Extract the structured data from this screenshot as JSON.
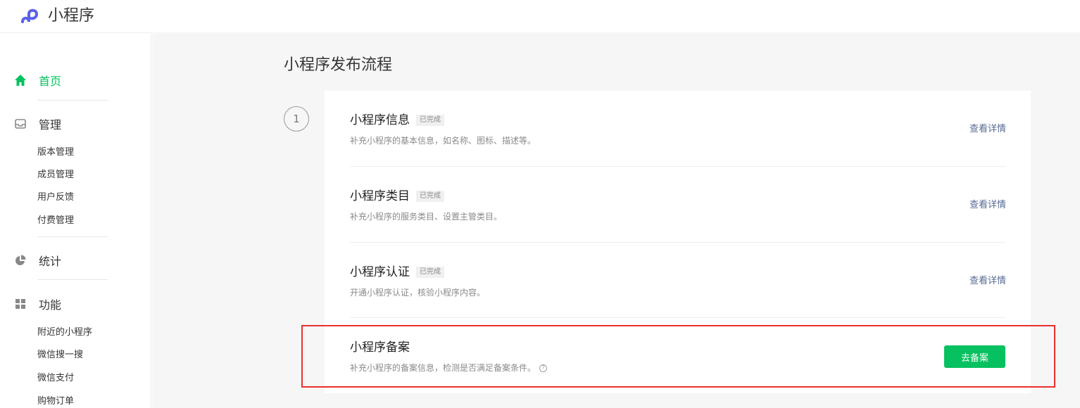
{
  "app": {
    "brand": "小程序"
  },
  "sidebar": {
    "home": "首页",
    "manage": "管理",
    "manage_items": [
      "版本管理",
      "成员管理",
      "用户反馈",
      "付费管理"
    ],
    "stats": "统计",
    "features": "功能",
    "feature_items": [
      "附近的小程序",
      "微信搜一搜",
      "微信支付",
      "购物订单"
    ]
  },
  "main": {
    "title": "小程序发布流程",
    "step_number": "1",
    "rows": [
      {
        "title": "小程序信息",
        "badge": "已完成",
        "desc": "补充小程序的基本信息，如名称、图标、描述等。",
        "link": "查看详情"
      },
      {
        "title": "小程序类目",
        "badge": "已完成",
        "desc": "补充小程序的服务类目、设置主管类目。",
        "link": "查看详情"
      },
      {
        "title": "小程序认证",
        "badge": "已完成",
        "desc": "开通小程序认证，核验小程序内容。",
        "link": "查看详情"
      },
      {
        "title": "小程序备案",
        "desc": "补充小程序的备案信息，检测是否满足备案条件。",
        "button": "去备案"
      }
    ],
    "help_glyph": "?"
  },
  "colors": {
    "accent": "#07c160",
    "link": "#576b95",
    "highlight": "#e8312d",
    "logo": "#5a62e8"
  },
  "icons": {
    "logo": "miniprogram-logo-icon",
    "home": "home-icon",
    "manage": "inbox-icon",
    "stats": "pie-chart-icon",
    "features": "grid-icon",
    "help": "question-circle-icon"
  }
}
